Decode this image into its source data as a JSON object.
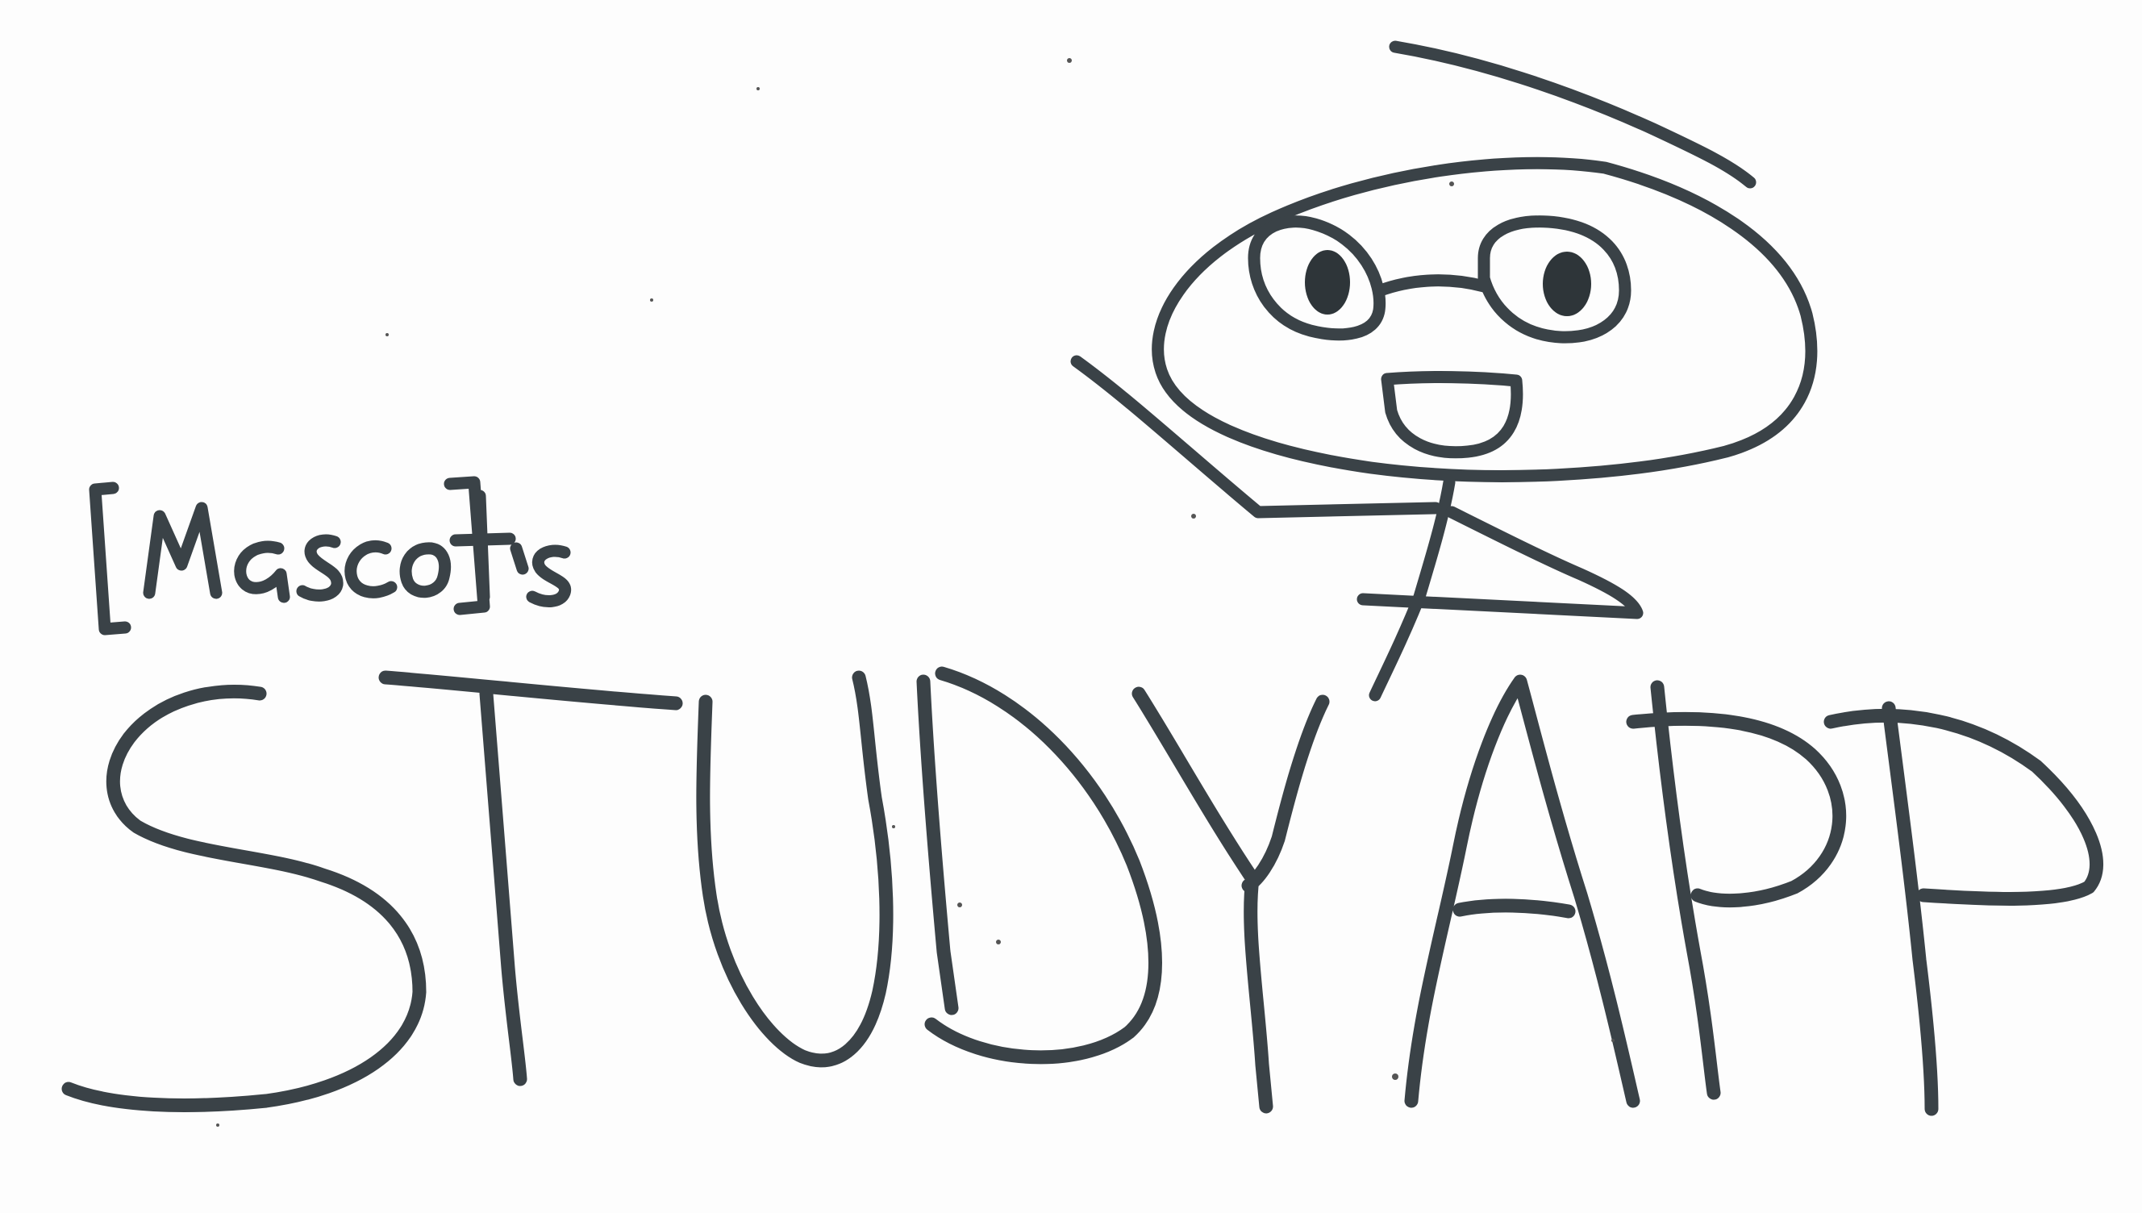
{
  "subtitle": "[Mascot]'s",
  "title": "STUDYAPP",
  "colors": {
    "background": "#fdfdfd",
    "ink": "#3a4247"
  },
  "mascot": {
    "icon": "stick-figure-mascot-icon",
    "features": [
      "glasses",
      "open-smile",
      "waving-arm"
    ]
  }
}
